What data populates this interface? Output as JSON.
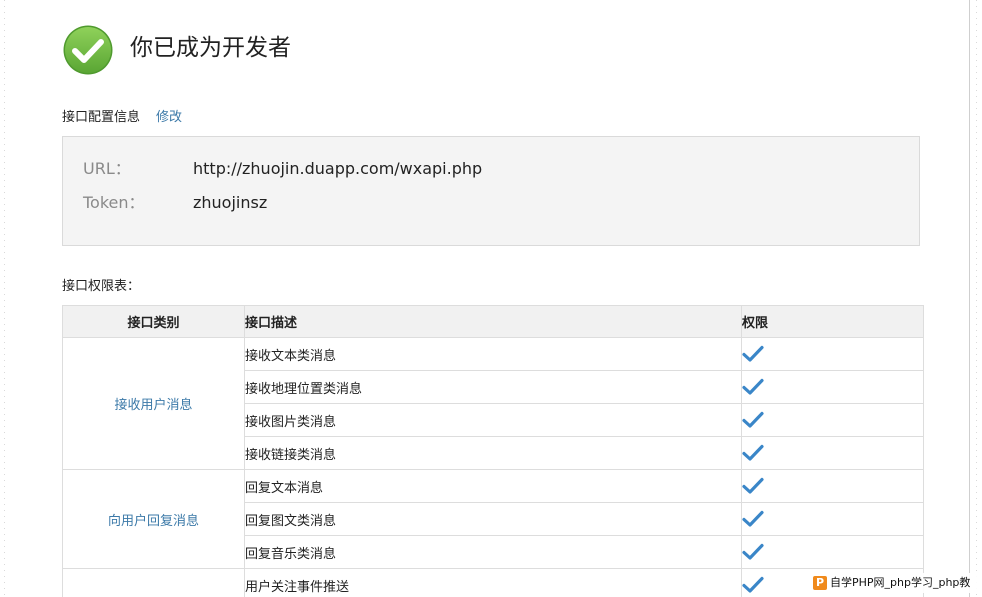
{
  "success": {
    "icon": "check-circle-icon",
    "title": "你已成为开发者"
  },
  "config": {
    "label": "接口配置信息",
    "edit_link": "修改",
    "url_key": "URL：",
    "url_value": "http://zhuojin.duapp.com/wxapi.php",
    "token_key": "Token：",
    "token_value": "zhuojinsz"
  },
  "permissions": {
    "label": "接口权限表：",
    "headers": {
      "category": "接口类别",
      "description": "接口描述",
      "permission": "权限"
    },
    "groups": [
      {
        "category": "接收用户消息",
        "items": [
          "接收文本类消息",
          "接收地理位置类消息",
          "接收图片类消息",
          "接收链接类消息"
        ]
      },
      {
        "category": "向用户回复消息",
        "items": [
          "回复文本消息",
          "回复图文类消息",
          "回复音乐类消息"
        ]
      },
      {
        "category": "",
        "items": [
          "用户关注事件推送"
        ]
      }
    ],
    "check_icon": "checkmark-icon",
    "check_color": "#3a86c8"
  },
  "colors": {
    "link": "#3b79a8",
    "success_green": "#6cb33e",
    "check_blue": "#3a86c8"
  },
  "watermark": {
    "logo": "P",
    "text": "自学PHP网_php学习_php教"
  }
}
